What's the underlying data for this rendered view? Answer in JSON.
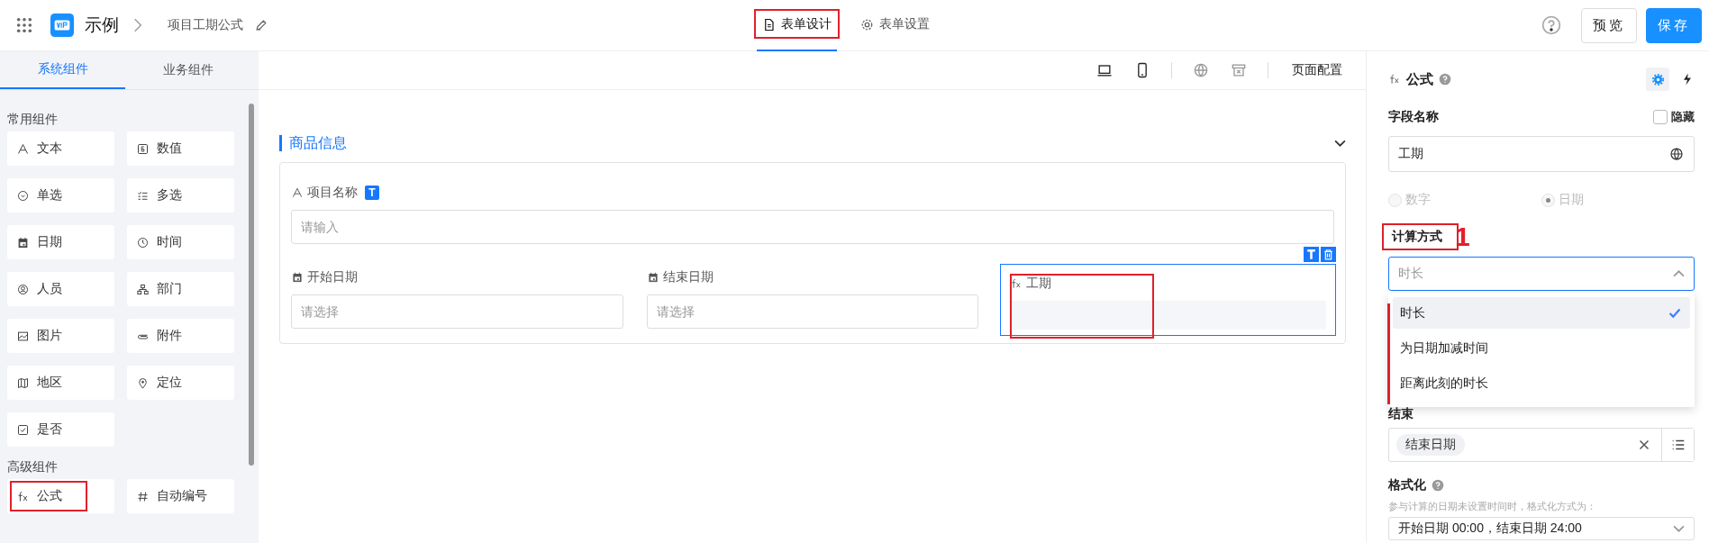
{
  "header": {
    "app_name": "示例",
    "breadcrumb": "项目工期公式",
    "tabs": [
      {
        "label": "表单设计",
        "selected": true,
        "annotated": true
      },
      {
        "label": "表单设置",
        "selected": false,
        "annotated": false
      }
    ],
    "buttons": [
      {
        "label": "预览",
        "kind": "plain"
      },
      {
        "label": "保存",
        "kind": "primary"
      }
    ]
  },
  "sidebar": {
    "tabs": [
      {
        "label": "系统组件",
        "selected": true
      },
      {
        "label": "业务组件",
        "selected": false
      }
    ],
    "groups": [
      {
        "title": "常用组件",
        "items": [
          {
            "label": "文本",
            "kind": "text",
            "annotated": false
          },
          {
            "label": "数值",
            "kind": "number",
            "annotated": false
          },
          {
            "label": "单选",
            "kind": "radio",
            "annotated": false
          },
          {
            "label": "多选",
            "kind": "multi",
            "annotated": false
          },
          {
            "label": "日期",
            "kind": "date",
            "annotated": false
          },
          {
            "label": "时间",
            "kind": "time",
            "annotated": false
          },
          {
            "label": "人员",
            "kind": "person",
            "annotated": false
          },
          {
            "label": "部门",
            "kind": "dept",
            "annotated": false
          },
          {
            "label": "图片",
            "kind": "image",
            "annotated": false
          },
          {
            "label": "附件",
            "kind": "attach",
            "annotated": false
          },
          {
            "label": "地区",
            "kind": "map",
            "annotated": false
          },
          {
            "label": "定位",
            "kind": "pin",
            "annotated": false
          },
          {
            "label": "是否",
            "kind": "bool",
            "annotated": false
          }
        ]
      },
      {
        "title": "高级组件",
        "items": [
          {
            "label": "公式",
            "kind": "formula",
            "annotated": true
          },
          {
            "label": "自动编号",
            "kind": "serial",
            "annotated": false
          }
        ]
      }
    ]
  },
  "canvas": {
    "toolbar": {
      "page_config": "页面配置"
    },
    "section": {
      "title": "商品信息",
      "expanded": true,
      "fields": [
        {
          "label": "项目名称",
          "kind": "text",
          "placeholder": "请输入",
          "selected": false,
          "annotated": false,
          "badge": "T"
        },
        {
          "label": "开始日期",
          "kind": "date",
          "placeholder": "请选择",
          "selected": false,
          "annotated": false
        },
        {
          "label": "结束日期",
          "kind": "date",
          "placeholder": "请选择",
          "selected": false,
          "annotated": false
        },
        {
          "label": "工期",
          "kind": "formula",
          "selected": true,
          "annotated": true
        }
      ]
    }
  },
  "panel": {
    "title": "公式",
    "field_name_label": "字段名称",
    "hidden": {
      "label": "隐藏",
      "checked": false
    },
    "field_name": "工期",
    "result_types": [
      {
        "label": "数字",
        "selected": false,
        "disabled": true
      },
      {
        "label": "日期",
        "selected": true,
        "disabled": true
      }
    ],
    "calc": {
      "label": "计算方式",
      "annotated": true,
      "annotation_number": "1",
      "value": "时长",
      "open": true,
      "options": [
        {
          "label": "时长",
          "selected": true
        },
        {
          "label": "为日期加减时间",
          "selected": false
        },
        {
          "label": "距离此刻的时长",
          "selected": false
        }
      ]
    },
    "end_label": "结束",
    "end_value": "结束日期",
    "format_label": "格式化",
    "format_hint": "参与计算的日期未设置时间时，格式化方式为：",
    "format_value": "开始日期 00:00，结束日期 24:00"
  }
}
